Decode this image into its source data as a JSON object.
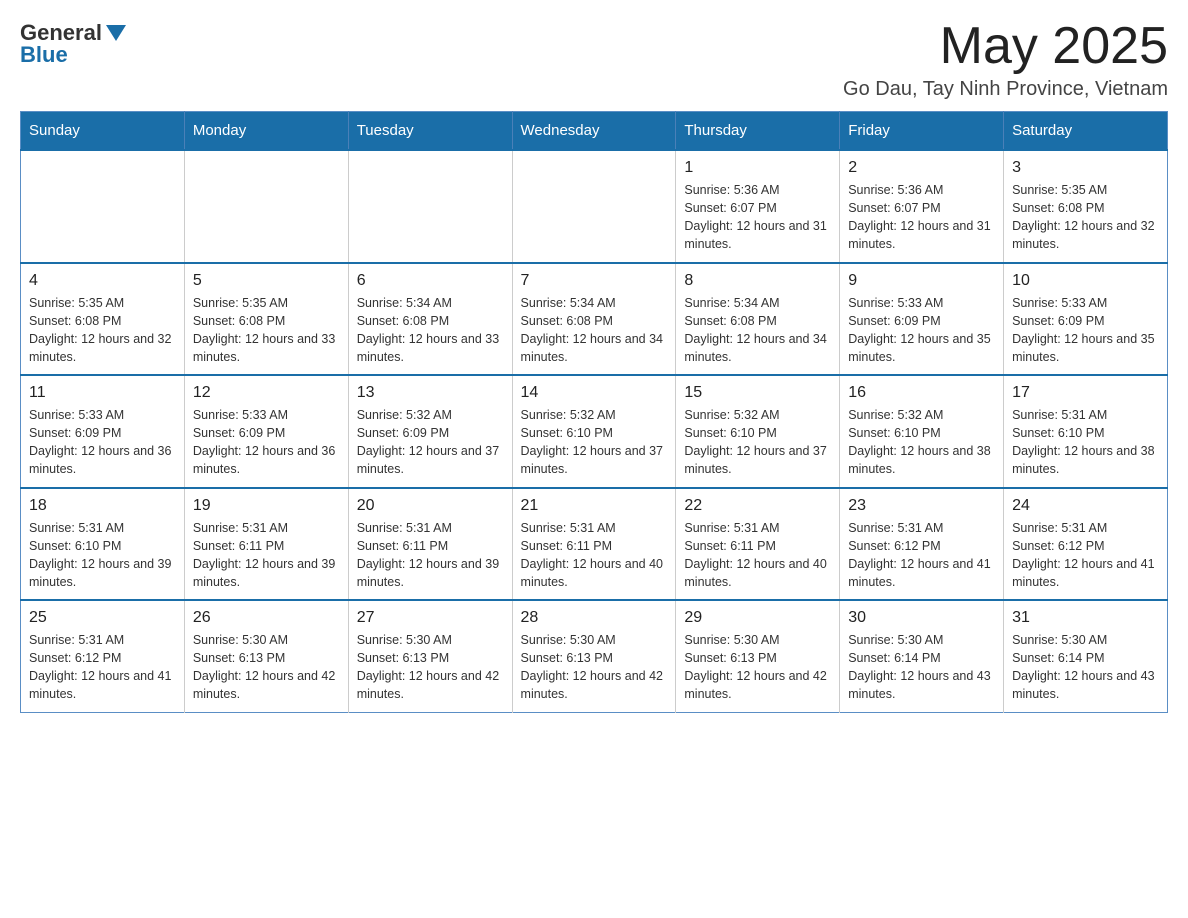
{
  "header": {
    "logo_general": "General",
    "logo_blue": "Blue",
    "month_title": "May 2025",
    "location": "Go Dau, Tay Ninh Province, Vietnam"
  },
  "calendar": {
    "days_of_week": [
      "Sunday",
      "Monday",
      "Tuesday",
      "Wednesday",
      "Thursday",
      "Friday",
      "Saturday"
    ],
    "weeks": [
      [
        {
          "day": "",
          "info": ""
        },
        {
          "day": "",
          "info": ""
        },
        {
          "day": "",
          "info": ""
        },
        {
          "day": "",
          "info": ""
        },
        {
          "day": "1",
          "info": "Sunrise: 5:36 AM\nSunset: 6:07 PM\nDaylight: 12 hours and 31 minutes."
        },
        {
          "day": "2",
          "info": "Sunrise: 5:36 AM\nSunset: 6:07 PM\nDaylight: 12 hours and 31 minutes."
        },
        {
          "day": "3",
          "info": "Sunrise: 5:35 AM\nSunset: 6:08 PM\nDaylight: 12 hours and 32 minutes."
        }
      ],
      [
        {
          "day": "4",
          "info": "Sunrise: 5:35 AM\nSunset: 6:08 PM\nDaylight: 12 hours and 32 minutes."
        },
        {
          "day": "5",
          "info": "Sunrise: 5:35 AM\nSunset: 6:08 PM\nDaylight: 12 hours and 33 minutes."
        },
        {
          "day": "6",
          "info": "Sunrise: 5:34 AM\nSunset: 6:08 PM\nDaylight: 12 hours and 33 minutes."
        },
        {
          "day": "7",
          "info": "Sunrise: 5:34 AM\nSunset: 6:08 PM\nDaylight: 12 hours and 34 minutes."
        },
        {
          "day": "8",
          "info": "Sunrise: 5:34 AM\nSunset: 6:08 PM\nDaylight: 12 hours and 34 minutes."
        },
        {
          "day": "9",
          "info": "Sunrise: 5:33 AM\nSunset: 6:09 PM\nDaylight: 12 hours and 35 minutes."
        },
        {
          "day": "10",
          "info": "Sunrise: 5:33 AM\nSunset: 6:09 PM\nDaylight: 12 hours and 35 minutes."
        }
      ],
      [
        {
          "day": "11",
          "info": "Sunrise: 5:33 AM\nSunset: 6:09 PM\nDaylight: 12 hours and 36 minutes."
        },
        {
          "day": "12",
          "info": "Sunrise: 5:33 AM\nSunset: 6:09 PM\nDaylight: 12 hours and 36 minutes."
        },
        {
          "day": "13",
          "info": "Sunrise: 5:32 AM\nSunset: 6:09 PM\nDaylight: 12 hours and 37 minutes."
        },
        {
          "day": "14",
          "info": "Sunrise: 5:32 AM\nSunset: 6:10 PM\nDaylight: 12 hours and 37 minutes."
        },
        {
          "day": "15",
          "info": "Sunrise: 5:32 AM\nSunset: 6:10 PM\nDaylight: 12 hours and 37 minutes."
        },
        {
          "day": "16",
          "info": "Sunrise: 5:32 AM\nSunset: 6:10 PM\nDaylight: 12 hours and 38 minutes."
        },
        {
          "day": "17",
          "info": "Sunrise: 5:31 AM\nSunset: 6:10 PM\nDaylight: 12 hours and 38 minutes."
        }
      ],
      [
        {
          "day": "18",
          "info": "Sunrise: 5:31 AM\nSunset: 6:10 PM\nDaylight: 12 hours and 39 minutes."
        },
        {
          "day": "19",
          "info": "Sunrise: 5:31 AM\nSunset: 6:11 PM\nDaylight: 12 hours and 39 minutes."
        },
        {
          "day": "20",
          "info": "Sunrise: 5:31 AM\nSunset: 6:11 PM\nDaylight: 12 hours and 39 minutes."
        },
        {
          "day": "21",
          "info": "Sunrise: 5:31 AM\nSunset: 6:11 PM\nDaylight: 12 hours and 40 minutes."
        },
        {
          "day": "22",
          "info": "Sunrise: 5:31 AM\nSunset: 6:11 PM\nDaylight: 12 hours and 40 minutes."
        },
        {
          "day": "23",
          "info": "Sunrise: 5:31 AM\nSunset: 6:12 PM\nDaylight: 12 hours and 41 minutes."
        },
        {
          "day": "24",
          "info": "Sunrise: 5:31 AM\nSunset: 6:12 PM\nDaylight: 12 hours and 41 minutes."
        }
      ],
      [
        {
          "day": "25",
          "info": "Sunrise: 5:31 AM\nSunset: 6:12 PM\nDaylight: 12 hours and 41 minutes."
        },
        {
          "day": "26",
          "info": "Sunrise: 5:30 AM\nSunset: 6:13 PM\nDaylight: 12 hours and 42 minutes."
        },
        {
          "day": "27",
          "info": "Sunrise: 5:30 AM\nSunset: 6:13 PM\nDaylight: 12 hours and 42 minutes."
        },
        {
          "day": "28",
          "info": "Sunrise: 5:30 AM\nSunset: 6:13 PM\nDaylight: 12 hours and 42 minutes."
        },
        {
          "day": "29",
          "info": "Sunrise: 5:30 AM\nSunset: 6:13 PM\nDaylight: 12 hours and 42 minutes."
        },
        {
          "day": "30",
          "info": "Sunrise: 5:30 AM\nSunset: 6:14 PM\nDaylight: 12 hours and 43 minutes."
        },
        {
          "day": "31",
          "info": "Sunrise: 5:30 AM\nSunset: 6:14 PM\nDaylight: 12 hours and 43 minutes."
        }
      ]
    ]
  }
}
